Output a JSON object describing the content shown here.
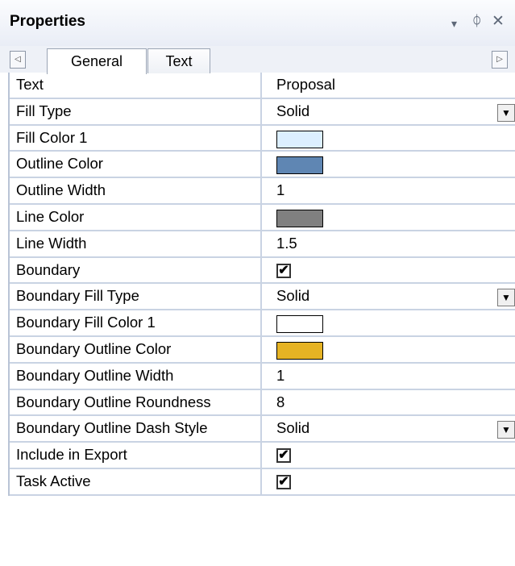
{
  "panel": {
    "title": "Properties",
    "buttons": {
      "dropdown": "▾",
      "pin": "ᛰ",
      "close": "✕"
    }
  },
  "tabs": {
    "scroll_left": "◁",
    "scroll_right": "▷",
    "items": [
      {
        "label": "General",
        "active": true
      },
      {
        "label": "Text",
        "active": false
      }
    ]
  },
  "properties": [
    {
      "name": "Text",
      "value": "Proposal",
      "kind": "text"
    },
    {
      "name": "Fill Type",
      "value": "Solid",
      "kind": "dropdown"
    },
    {
      "name": "Fill Color 1",
      "kind": "color",
      "color": "#dcefff"
    },
    {
      "name": "Outline Color",
      "kind": "color",
      "color": "#5f86b3"
    },
    {
      "name": "Outline Width",
      "value": "1",
      "kind": "text"
    },
    {
      "name": "Line Color",
      "kind": "color",
      "color": "#808080"
    },
    {
      "name": "Line Width",
      "value": "1.5",
      "kind": "text"
    },
    {
      "name": "Boundary",
      "kind": "checkbox",
      "checked": true
    },
    {
      "name": "Boundary Fill Type",
      "value": "Solid",
      "kind": "dropdown"
    },
    {
      "name": "Boundary Fill Color 1",
      "kind": "color",
      "color": "#ffffff"
    },
    {
      "name": "Boundary Outline Color",
      "kind": "color",
      "color": "#e6b324"
    },
    {
      "name": "Boundary Outline Width",
      "value": "1",
      "kind": "text"
    },
    {
      "name": "Boundary Outline Roundness",
      "value": "8",
      "kind": "text"
    },
    {
      "name": "Boundary Outline Dash Style",
      "value": "Solid",
      "kind": "dropdown"
    },
    {
      "name": "Include in Export",
      "kind": "checkbox",
      "checked": true
    },
    {
      "name": "Task Active",
      "kind": "checkbox",
      "checked": true
    }
  ],
  "icons": {
    "dropdown_arrow": "▼",
    "check": "✔"
  }
}
